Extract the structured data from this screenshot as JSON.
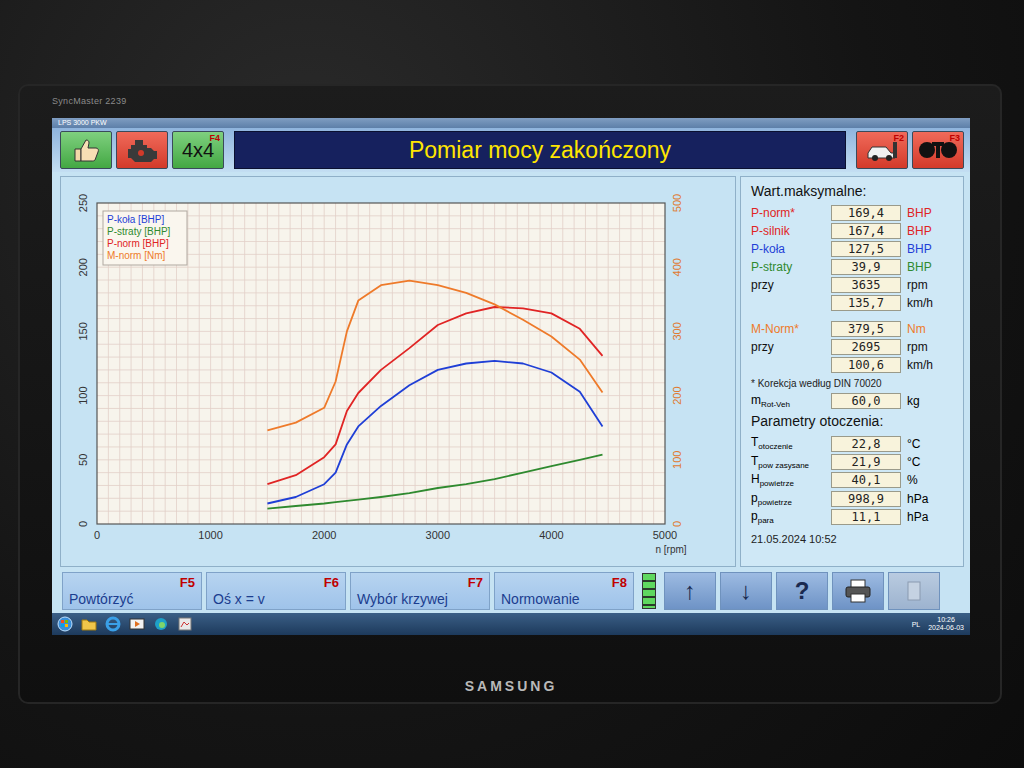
{
  "monitor": {
    "model": "SyncMaster 2239",
    "brand": "SAMSUNG"
  },
  "window": {
    "title": "LPS 3000 PKW"
  },
  "toolbar": {
    "left": [
      {
        "kind": "thumb",
        "key": ""
      },
      {
        "kind": "engine",
        "key": ""
      },
      {
        "kind": "drive",
        "label": "4x4",
        "key": "F4"
      }
    ],
    "title": "Pomiar mocy zakończony",
    "right": [
      {
        "kind": "car",
        "key": "F2"
      },
      {
        "kind": "rollers",
        "key": "F3"
      }
    ]
  },
  "chart": {
    "left_ticks": [
      "0",
      "50",
      "100",
      "150",
      "200",
      "250"
    ],
    "right_ticks": [
      "0",
      "100",
      "200",
      "300",
      "400",
      "500"
    ],
    "x_ticks": [
      "0",
      "1000",
      "2000",
      "3000",
      "4000",
      "5000"
    ],
    "x_label": "n [rpm]",
    "rpm": [
      1500,
      1750,
      2000,
      2100,
      2200,
      2300,
      2500,
      2750,
      3000,
      3250,
      3500,
      3750,
      4000,
      4250,
      4450
    ],
    "series": [
      {
        "name": "P-koła [BHP]",
        "kind": "power",
        "color": "#1f3fd6",
        "values": [
          16,
          21,
          31,
          40,
          62,
          76,
          92,
          108,
          120,
          125,
          127,
          125,
          118,
          103,
          76
        ]
      },
      {
        "name": "P-straty [BHP]",
        "kind": "power",
        "color": "#2f8a2f",
        "values": [
          12,
          14,
          16,
          17,
          18,
          19,
          21,
          24,
          28,
          31,
          35,
          40,
          45,
          50,
          54
        ]
      },
      {
        "name": "P-norm [BHP]",
        "kind": "power",
        "color": "#e02424",
        "values": [
          31,
          38,
          52,
          62,
          88,
          102,
          120,
          137,
          155,
          164,
          169,
          168,
          164,
          152,
          131
        ]
      },
      {
        "name": "M-norm [Nm]",
        "kind": "torque",
        "color": "#ee7a2a",
        "values": [
          146,
          158,
          181,
          222,
          300,
          348,
          372,
          379,
          372,
          360,
          342,
          318,
          292,
          256,
          205
        ]
      }
    ]
  },
  "maxima": {
    "heading": "Wart.maksymalne:",
    "power_rows": [
      {
        "label": "P-norm*",
        "value": "169,4",
        "unit": "BHP",
        "color": "#e02424"
      },
      {
        "label": "P-silnik",
        "value": "167,4",
        "unit": "BHP",
        "color": "#e02424"
      },
      {
        "label": "P-koła",
        "value": "127,5",
        "unit": "BHP",
        "color": "#1f3fd6"
      },
      {
        "label": "P-straty",
        "value": "39,9",
        "unit": "BHP",
        "color": "#2f8a2f"
      },
      {
        "label": "przy",
        "value": "3635",
        "unit": "rpm",
        "color": "#111111"
      },
      {
        "value": "135,7",
        "unit": "km/h",
        "color": "#111111"
      }
    ],
    "torque_rows": [
      {
        "label": "M-Norm*",
        "value": "379,5",
        "unit": "Nm",
        "color": "#ee7a2a"
      },
      {
        "label": "przy",
        "value": "2695",
        "unit": "rpm",
        "color": "#111111"
      },
      {
        "value": "100,6",
        "unit": "km/h",
        "color": "#111111"
      }
    ],
    "note": "* Korekcja według DIN 70020",
    "mass": {
      "label": "m",
      "sub": "Rot-Veh",
      "value": "60,0",
      "unit": "kg"
    }
  },
  "ambient": {
    "heading": "Parametry otoczenia:",
    "rows": [
      {
        "label": "T",
        "sub": "otoczenie",
        "value": "22,8",
        "unit": "°C"
      },
      {
        "label": "T",
        "sub": "pow zasysane",
        "value": "21,9",
        "unit": "°C"
      },
      {
        "label": "H",
        "sub": "powietrze",
        "value": "40,1",
        "unit": "%"
      },
      {
        "label": "p",
        "sub": "powietrze",
        "value": "998,9",
        "unit": "hPa"
      },
      {
        "label": "p",
        "sub": "para",
        "value": "11,1",
        "unit": "hPa"
      }
    ]
  },
  "date": "21.05.2024 10:52",
  "fbar": {
    "keys": [
      {
        "label": "Powtórzyć",
        "key": "F5"
      },
      {
        "label": "Oś x = v",
        "key": "F6"
      },
      {
        "label": "Wybór krzywej",
        "key": "F7"
      },
      {
        "label": "Normowanie",
        "key": "F8"
      }
    ],
    "meter": {
      "level": 1.0
    },
    "tools": [
      {
        "kind": "glyph",
        "glyph": "↑",
        "disabled": false
      },
      {
        "kind": "glyph",
        "glyph": "↓",
        "disabled": false
      },
      {
        "kind": "glyph",
        "glyph": "?",
        "disabled": false
      },
      {
        "kind": "printer",
        "disabled": false
      },
      {
        "kind": "blank",
        "disabled": true
      }
    ]
  },
  "taskbar": {
    "lang": "PL",
    "time": "10:26",
    "date": "2024-06-03"
  }
}
